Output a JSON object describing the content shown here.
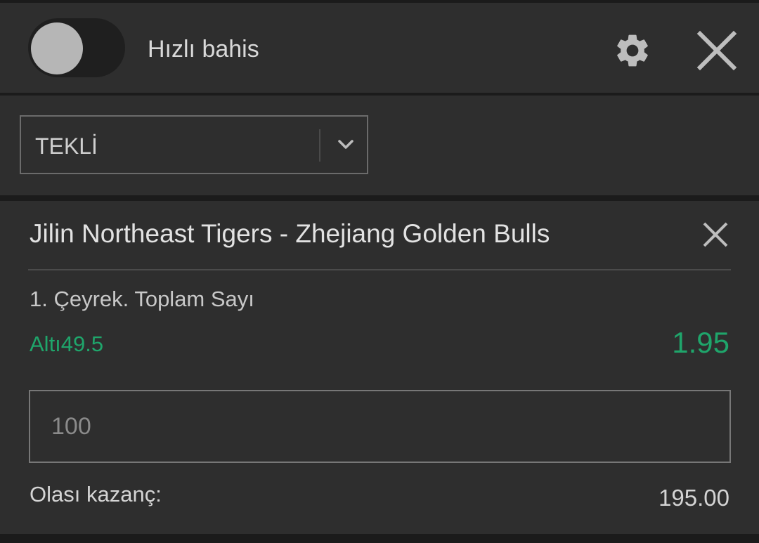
{
  "header": {
    "quick_bet_label": "Hızlı bahis",
    "quick_bet_enabled": false,
    "settings_icon": "gear-icon",
    "close_icon": "close-icon"
  },
  "bet_type": {
    "selected": "TEKLİ",
    "dropdown_icon": "chevron-down-icon"
  },
  "bet": {
    "match": "Jilin Northeast Tigers - Zhejiang Golden Bulls",
    "market": "1. Çeyrek. Toplam Sayı",
    "selection": "Altı49.5",
    "odds": "1.95",
    "stake_placeholder": "100",
    "winnings_label": "Olası kazanç:",
    "winnings_value": "195.00",
    "remove_icon": "close-icon"
  },
  "colors": {
    "background": "#2e2e2e",
    "accent_green": "#1fa56b",
    "text": "#e2e2e2"
  }
}
